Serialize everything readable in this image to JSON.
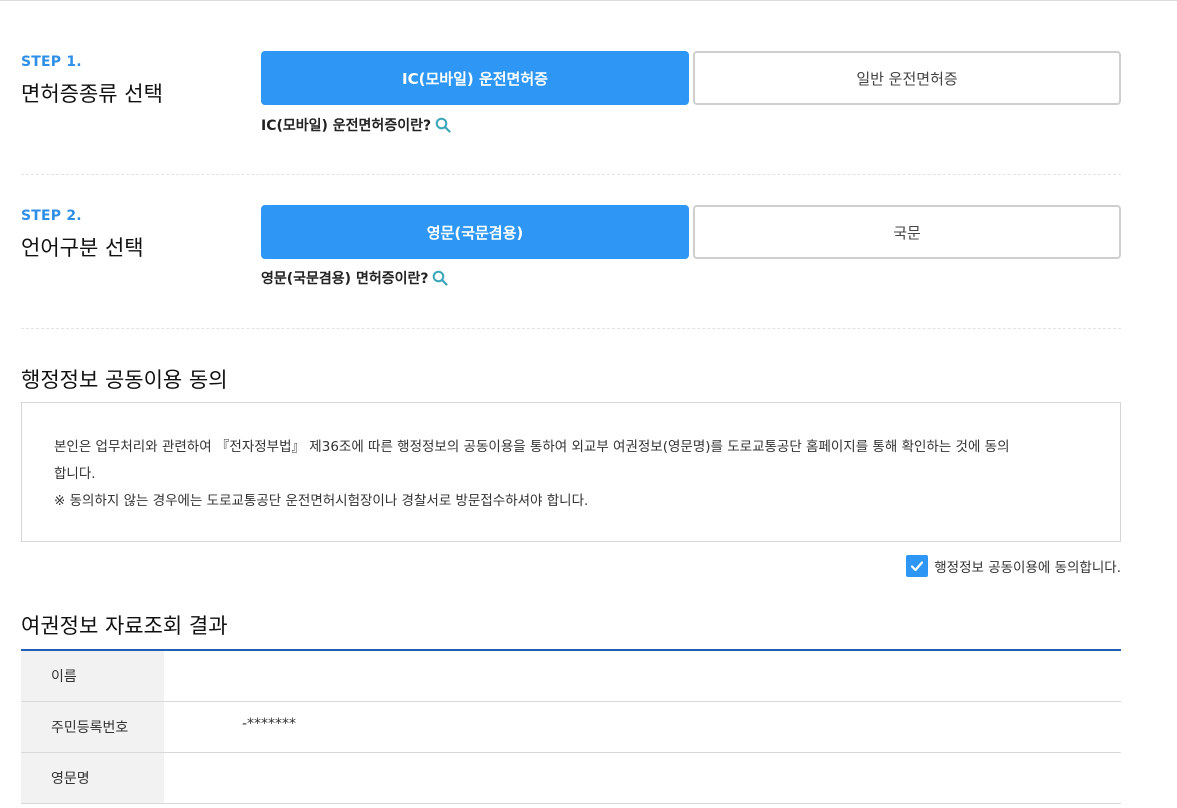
{
  "step1": {
    "label": "STEP 1.",
    "title": "면허증종류 선택",
    "options": [
      "IC(모바일) 운전면허증",
      "일반 운전면허증"
    ],
    "help": "IC(모바일) 운전면허증이란?"
  },
  "step2": {
    "label": "STEP 2.",
    "title": "언어구분 선택",
    "options": [
      "영문(국문겸용)",
      "국문"
    ],
    "help": "영문(국문겸용) 면허증이란?"
  },
  "consent": {
    "title": "행정정보 공동이용 동의",
    "line1": "본인은 업무처리와 관련하여 『전자정부법』 제36조에 따른 행정정보의 공동이용을 통하여 외교부 여권정보(영문명)를 도로교통공단 홈페이지를 통해 확인하는 것에 동의",
    "line2": "합니다.",
    "line3": "※ 동의하지 않는 경우에는 도로교통공단 운전면허시험장이나 경찰서로 방문접수하셔야 합니다.",
    "checkbox_label": "행정정보 공동이용에 동의합니다.",
    "checked": true
  },
  "result": {
    "title": "여권정보 자료조회 결과",
    "rows": [
      {
        "label": "이름",
        "value": ""
      },
      {
        "label": "주민등록번호",
        "value": "-*******"
      },
      {
        "label": "영문명",
        "value": ""
      }
    ]
  },
  "colors": {
    "accent": "#2e97f5",
    "step_label": "#2f8fe8",
    "table_border": "#1f5fb5"
  }
}
